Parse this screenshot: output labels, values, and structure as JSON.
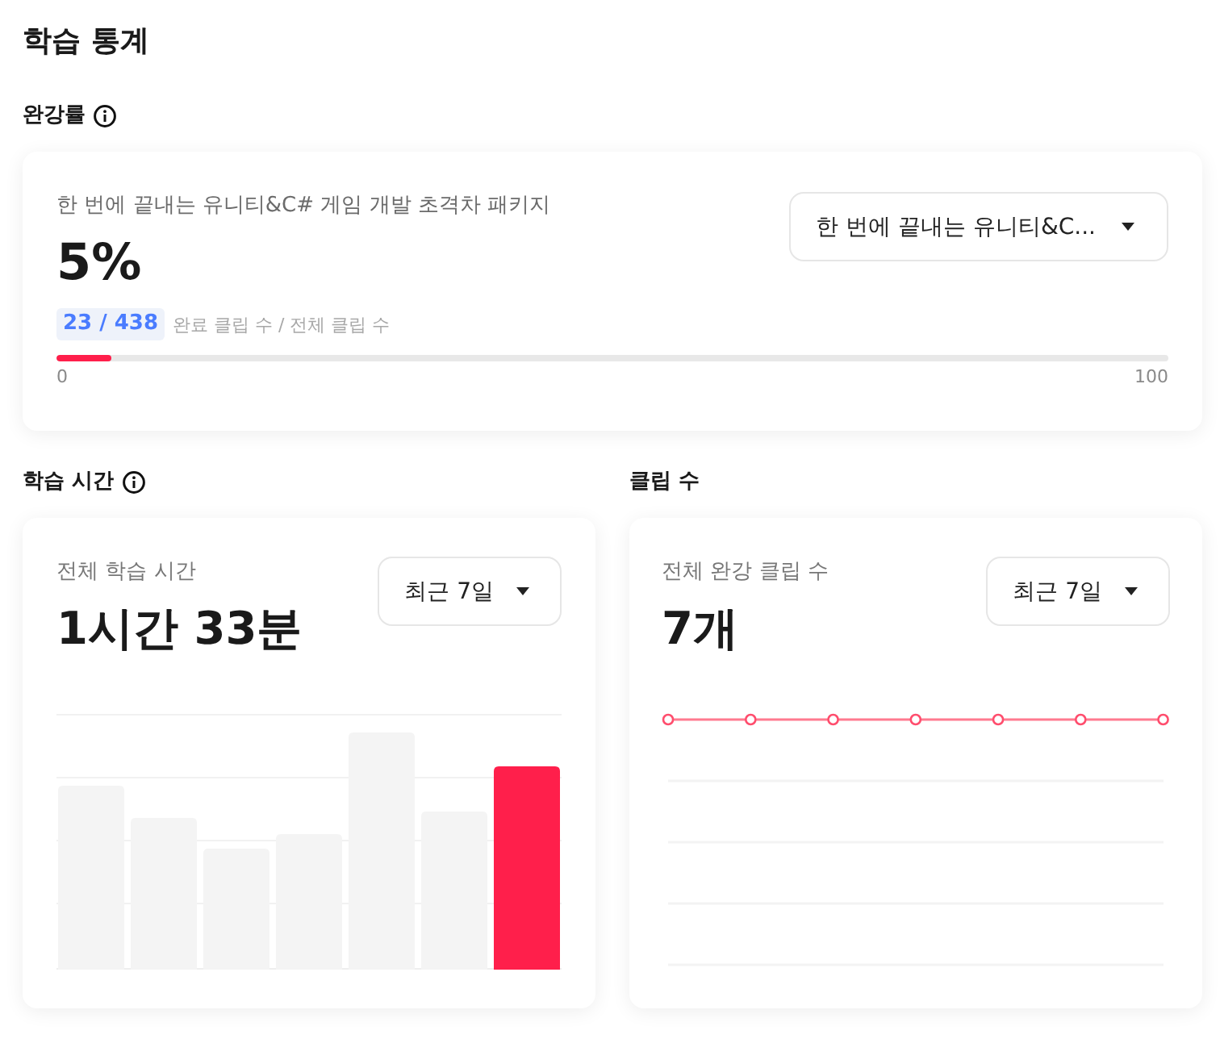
{
  "title": "학습 통계",
  "completion": {
    "label": "완강률",
    "info": true,
    "course": "한 번에 끝내는 유니티&C# 게임 개발 초격차 패키지",
    "percent": "5%",
    "count": "23 / 438",
    "count_caption": "완료 클립 수 / 전체 클립 수",
    "dropdown": {
      "value": "한 번에 끝내는 유니티&C..."
    },
    "progress": {
      "level": 0.05,
      "min_label": "0",
      "max_label": "100"
    }
  },
  "panels": [
    {
      "kind": "bar",
      "label": "학습 시간",
      "info": true,
      "caption": "전체 학습 시간",
      "value": "1시간 33분",
      "dropdown": {
        "value": "최근 7일"
      }
    },
    {
      "kind": "line",
      "label": "클립 수",
      "info": false,
      "caption": "전체 완강 클립 수",
      "value": "7개",
      "dropdown": {
        "value": "최근 7일"
      }
    }
  ]
}
